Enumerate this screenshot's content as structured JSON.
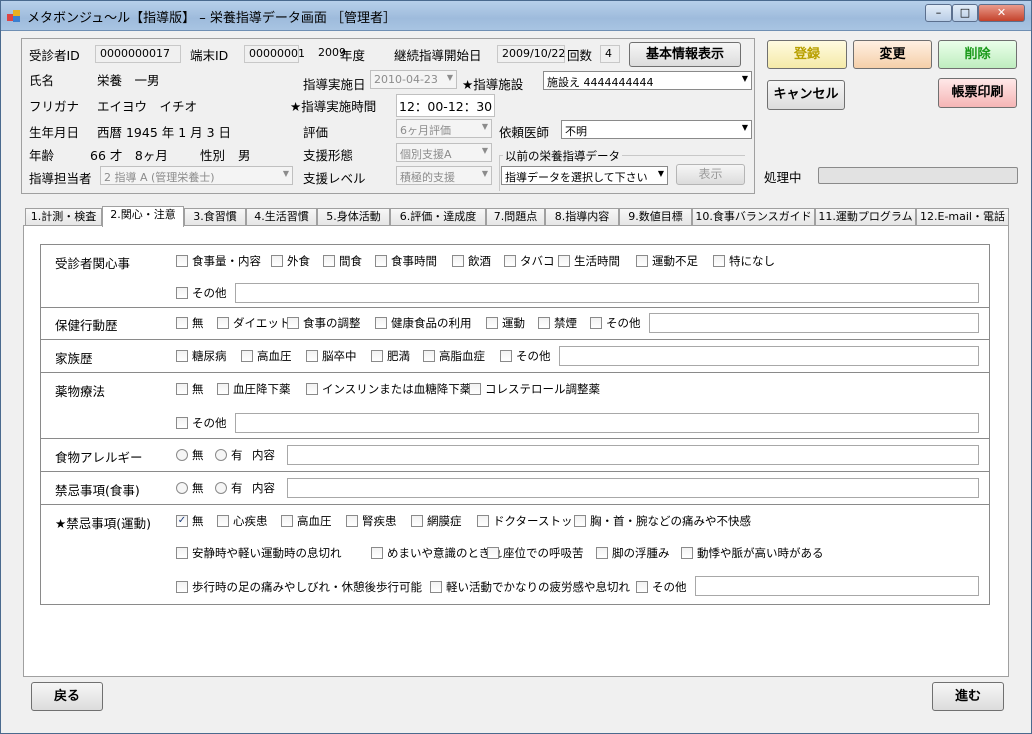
{
  "window": {
    "title": "メタボンジュ～ル【指導版】 – 栄養指導データ画面 ［管理者］",
    "minimize": "–",
    "maximize": "□",
    "close": "✕"
  },
  "header": {
    "id_label": "受診者ID",
    "id_value": "0000000017",
    "terminal_label": "端末ID",
    "terminal_value": "00000001",
    "year_value": "2009",
    "year_suffix": "年度",
    "cont_label": "継続指導開始日",
    "cont_value": "2009/10/22",
    "count_label": "回数",
    "count_value": "4",
    "name_label": "氏名",
    "name_value": "栄養　一男",
    "kana_label": "フリガナ",
    "kana_value": "エイヨウ　イチオ",
    "dob_label": "生年月日",
    "dob_value": "西暦 1945 年 1 月 3 日",
    "age_label": "年齢",
    "age_value": "66 才　8ヶ月",
    "sex_label": "性別",
    "sex_value": "男",
    "staff_label": "指導担当者",
    "staff_value": "2 指導 A (管理栄養士)",
    "date_label": "指導実施日",
    "date_value": "2010-04-23",
    "facility_label": "★指導施設",
    "facility_value": "施設え 4444444444",
    "time_label": "★指導実施時間",
    "time_value": "12：00-12：30",
    "eval_label": "評価",
    "eval_value": "6ヶ月評価",
    "doctor_label": "依頼医師",
    "doctor_value": "不明",
    "form_label": "支援形態",
    "form_value": "個別支援A",
    "prev_label": "以前の栄養指導データ",
    "prev_value": "指導データを選択して下さい",
    "level_label": "支援レベル",
    "level_value": "積極的支援",
    "show_button": "表示",
    "basic_button": "基本情報表示"
  },
  "actions": {
    "register": "登録",
    "change": "変更",
    "delete": "削除",
    "cancel": "キャンセル",
    "print": "帳票印刷",
    "processing": "処理中",
    "progress": 0
  },
  "tabs": [
    "1.計測・検査",
    "2.関心・注意",
    "3.食習慣",
    "4.生活習慣",
    "5.身体活動",
    "6.評価・達成度",
    "7.問題点",
    "8.指導内容",
    "9.数値目標",
    "10.食事バランスガイド",
    "11.運動プログラム",
    "12.E-mail・電話"
  ],
  "sections": {
    "concern": {
      "label": "受診者関心事",
      "items": [
        "食事量・内容",
        "外食",
        "間食",
        "食事時間",
        "飲酒",
        "タバコ",
        "生活時間",
        "運動不足",
        "特になし"
      ],
      "other": "その他"
    },
    "health": {
      "label": "保健行動歴",
      "items": [
        "無",
        "ダイエット",
        "食事の調整",
        "健康食品の利用",
        "運動",
        "禁煙",
        "その他"
      ]
    },
    "family": {
      "label": "家族歴",
      "items": [
        "糖尿病",
        "高血圧",
        "脳卒中",
        "肥満",
        "高脂血症",
        "その他"
      ]
    },
    "drug": {
      "label": "薬物療法",
      "items": [
        "無",
        "血圧降下薬",
        "インスリンまたは血糖降下薬",
        "コレステロール調整薬"
      ],
      "other": "その他"
    },
    "allergy": {
      "label": "食物アレルギー",
      "no": "無",
      "yes": "有",
      "content": "内容"
    },
    "taboo_food": {
      "label": "禁忌事項(食事)",
      "no": "無",
      "yes": "有",
      "content": "内容"
    },
    "taboo_ex": {
      "label": "★禁忌事項(運動)",
      "row1": [
        "無",
        "心疾患",
        "高血圧",
        "腎疾患",
        "網膜症",
        "ドクターストップ",
        "胸・首・腕などの痛みや不快感"
      ],
      "row2": [
        "安静時や軽い運動時の息切れ",
        "めまいや意識のとぎれ",
        "座位での呼吸苦",
        "脚の浮腫み",
        "動悸や脈が高い時がある"
      ],
      "row3": [
        "歩行時の足の痛みやしびれ・休憩後歩行可能",
        "軽い活動でかなりの疲労感や息切れ",
        "その他"
      ],
      "checked_mark": "✓"
    }
  },
  "footer": {
    "back": "戻る",
    "next": "進む"
  }
}
